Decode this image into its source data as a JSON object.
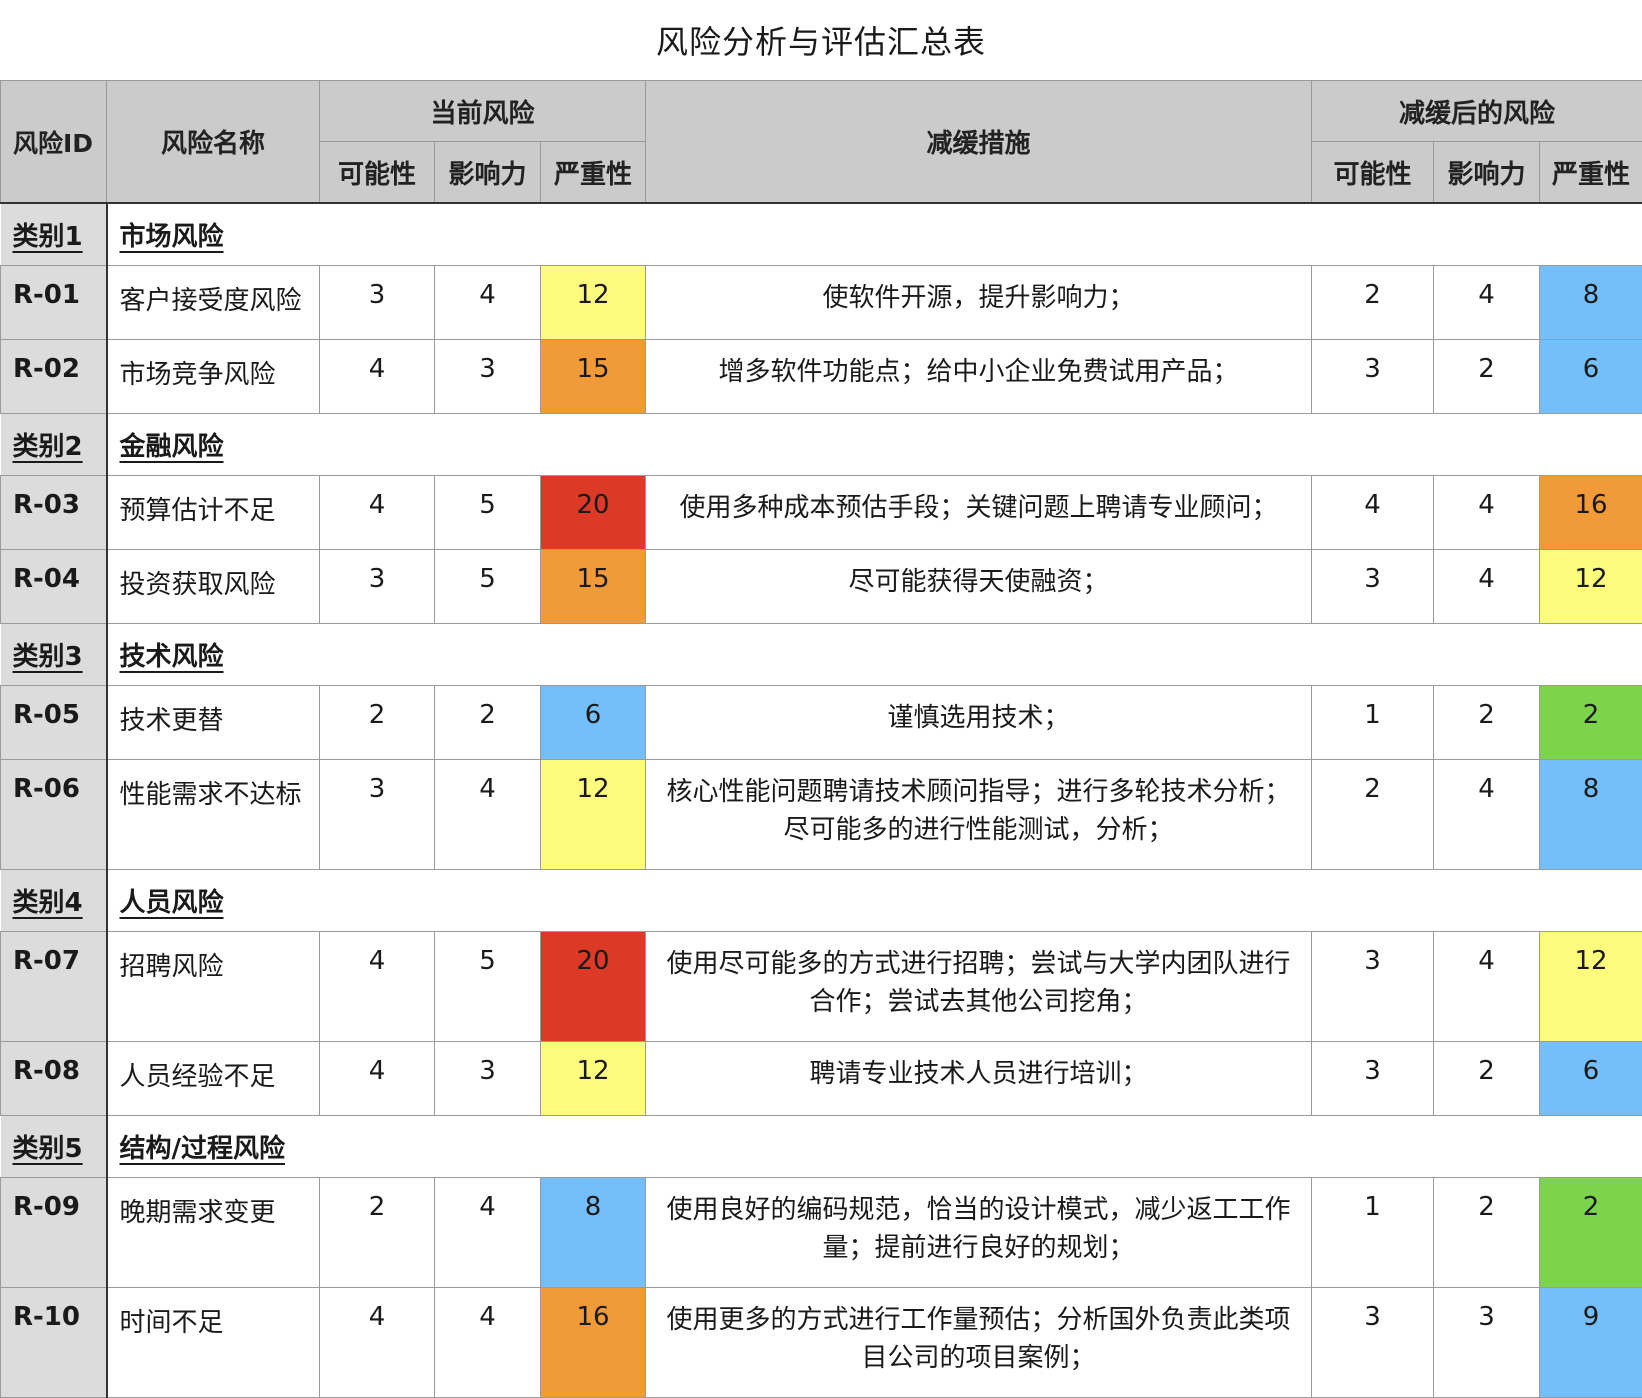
{
  "title": "风险分析与评估汇总表",
  "headers": {
    "id": "风险ID",
    "name": "风险名称",
    "current_risk": "当前风险",
    "mitigation": "减缓措施",
    "post_risk": "减缓后的风险",
    "likelihood": "可能性",
    "impact": "影响力",
    "severity": "严重性"
  },
  "colors": {
    "red": "#dc3a26",
    "orange": "#f19a38",
    "yellow": "#fdfb7d",
    "blue": "#74bffa",
    "green": "#7cd34c"
  },
  "categories": [
    {
      "label": "类别1",
      "name": "市场风险",
      "rows": [
        {
          "id": "R-01",
          "name": "客户接受度风险",
          "lk": "3",
          "im": "4",
          "sv": "12",
          "sv_color": "yellow",
          "mt": "使软件开源，提升影响力；",
          "lk2": "2",
          "im2": "4",
          "sv2": "8",
          "sv2_color": "blue"
        },
        {
          "id": "R-02",
          "name": "市场竞争风险",
          "lk": "4",
          "im": "3",
          "sv": "15",
          "sv_color": "orange",
          "mt": "增多软件功能点；给中小企业免费试用产品；",
          "lk2": "3",
          "im2": "2",
          "sv2": "6",
          "sv2_color": "blue"
        }
      ]
    },
    {
      "label": "类别2",
      "name": "金融风险",
      "rows": [
        {
          "id": "R-03",
          "name": "预算估计不足",
          "lk": "4",
          "im": "5",
          "sv": "20",
          "sv_color": "red",
          "mt": "使用多种成本预估手段；关键问题上聘请专业顾问；",
          "lk2": "4",
          "im2": "4",
          "sv2": "16",
          "sv2_color": "orange"
        },
        {
          "id": "R-04",
          "name": "投资获取风险",
          "lk": "3",
          "im": "5",
          "sv": "15",
          "sv_color": "orange",
          "mt": "尽可能获得天使融资；",
          "lk2": "3",
          "im2": "4",
          "sv2": "12",
          "sv2_color": "yellow"
        }
      ]
    },
    {
      "label": "类别3",
      "name": "技术风险",
      "rows": [
        {
          "id": "R-05",
          "name": "技术更替",
          "lk": "2",
          "im": "2",
          "sv": "6",
          "sv_color": "blue",
          "mt": "谨慎选用技术；",
          "lk2": "1",
          "im2": "2",
          "sv2": "2",
          "sv2_color": "green"
        },
        {
          "id": "R-06",
          "name": "性能需求不达标",
          "lk": "3",
          "im": "4",
          "sv": "12",
          "sv_color": "yellow",
          "mt": "核心性能问题聘请技术顾问指导；进行多轮技术分析；尽可能多的进行性能测试，分析；",
          "lk2": "2",
          "im2": "4",
          "sv2": "8",
          "sv2_color": "blue"
        }
      ]
    },
    {
      "label": "类别4",
      "name": "人员风险",
      "rows": [
        {
          "id": "R-07",
          "name": "招聘风险",
          "lk": "4",
          "im": "5",
          "sv": "20",
          "sv_color": "red",
          "mt": "使用尽可能多的方式进行招聘；尝试与大学内团队进行合作；尝试去其他公司挖角；",
          "lk2": "3",
          "im2": "4",
          "sv2": "12",
          "sv2_color": "yellow"
        },
        {
          "id": "R-08",
          "name": "人员经验不足",
          "lk": "4",
          "im": "3",
          "sv": "12",
          "sv_color": "yellow",
          "mt": "聘请专业技术人员进行培训；",
          "lk2": "3",
          "im2": "2",
          "sv2": "6",
          "sv2_color": "blue"
        }
      ]
    },
    {
      "label": "类别5",
      "name": "结构/过程风险",
      "rows": [
        {
          "id": "R-09",
          "name": "晚期需求变更",
          "lk": "2",
          "im": "4",
          "sv": "8",
          "sv_color": "blue",
          "mt": "使用良好的编码规范，恰当的设计模式，减少返工工作量；提前进行良好的规划；",
          "lk2": "1",
          "im2": "2",
          "sv2": "2",
          "sv2_color": "green"
        },
        {
          "id": "R-10",
          "name": "时间不足",
          "lk": "4",
          "im": "4",
          "sv": "16",
          "sv_color": "orange",
          "mt": "使用更多的方式进行工作量预估；分析国外负责此类项目公司的项目案例；",
          "lk2": "3",
          "im2": "3",
          "sv2": "9",
          "sv2_color": "blue"
        }
      ]
    }
  ]
}
